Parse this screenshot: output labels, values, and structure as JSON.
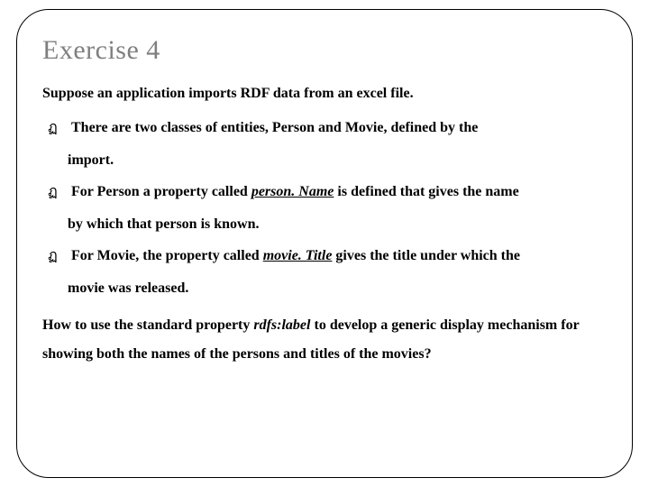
{
  "title": "Exercise 4",
  "intro": "Suppose an application imports RDF data from an excel file.",
  "bullets": [
    {
      "line1": " There are two classes of entities, Person and Movie, defined by the",
      "cont": "import."
    },
    {
      "pre": "For Person a property called ",
      "emph": "person. Name",
      "post": " is defined that gives the name",
      "cont": "by which that person is known."
    },
    {
      "pre": "For Movie, the property called ",
      "emph": "movie. Title",
      "post": " gives the title under which the",
      "cont": "movie was released."
    }
  ],
  "question": {
    "pre": "How to use the standard property ",
    "emph": "rdfs:label",
    "post": " to develop a generic display mechanism for showing both the names of the persons and titles of the movies?"
  }
}
